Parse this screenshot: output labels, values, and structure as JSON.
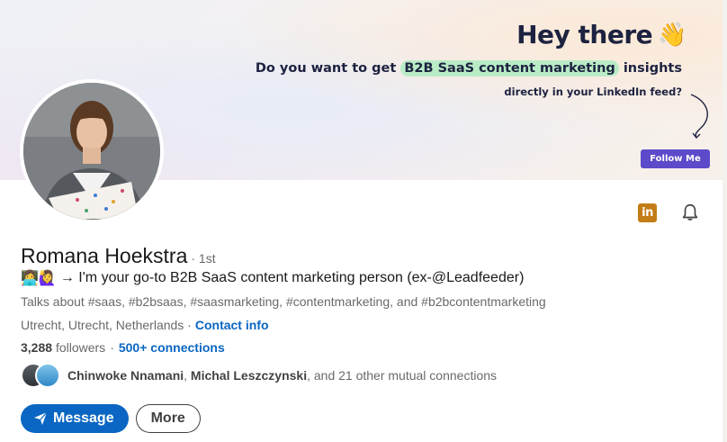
{
  "banner": {
    "greeting": "Hey there",
    "wave_emoji": "👋",
    "pitch_prefix": "Do you want to get ",
    "pitch_highlight": "B2B SaaS content marketing",
    "pitch_suffix": " insights",
    "pitch_line2": "directly in your LinkedIn feed?",
    "follow_button": "Follow Me",
    "highlight_color": "#b9ecc6",
    "button_color": "#5b4ac9"
  },
  "profile": {
    "name": "Romana Hoekstra",
    "degree": "· 1st",
    "headline_emoji": "👩‍💻🙋‍♀️",
    "headline": "→ I'm your go-to B2B SaaS content marketing person (ex-@Leadfeeder)",
    "talks_about": "Talks about #saas, #b2bsaas, #saasmarketing, #contentmarketing, and #b2bcontentmarketing",
    "location": "Utrecht, Utrecht, Netherlands ·",
    "contact_info": "Contact info",
    "followers_count": "3,288",
    "followers_label": "followers",
    "connections_sep": "·",
    "connections": "500+ connections"
  },
  "mutual": {
    "name1": "Chinwoke Nnamani",
    "sep": ",",
    "name2": "Michal Leszczynski",
    "rest": ", and 21 other mutual connections"
  },
  "actions": {
    "message": "Message",
    "more": "More"
  },
  "icons": {
    "linkedin_badge": "in",
    "linkedin_color": "#c37d16",
    "accent": "#0a66c2"
  }
}
